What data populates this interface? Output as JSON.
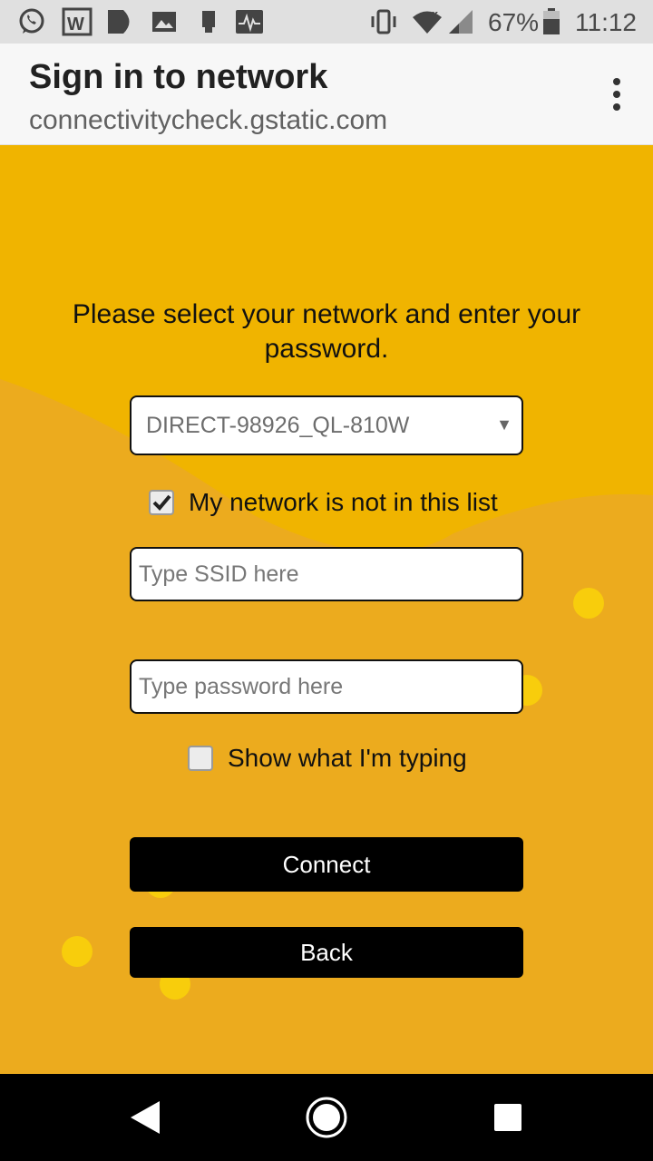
{
  "status_bar": {
    "battery_percent": "67%",
    "time": "11:12",
    "left_icons": [
      "whatsapp-icon",
      "word-icon",
      "play-icon",
      "gallery-icon",
      "sim-icon",
      "activity-icon"
    ],
    "right_icons": [
      "vibrate-icon",
      "wifi-icon",
      "signal-icon",
      "battery-icon"
    ]
  },
  "app_bar": {
    "title": "Sign in to network",
    "subtitle": "connectivitycheck.gstatic.com",
    "menu_icon": "more-vert-icon"
  },
  "form": {
    "prompt": "Please select your network and enter your password.",
    "network_select": {
      "selected_value": "DIRECT-98926_QL-810W"
    },
    "not_in_list": {
      "label": "My network is not in this list",
      "checked": true
    },
    "ssid_input": {
      "placeholder": "Type SSID here",
      "value": ""
    },
    "password_input": {
      "placeholder": "Type password here",
      "value": ""
    },
    "show_typing": {
      "label": "Show what I'm typing",
      "checked": false
    },
    "connect_label": "Connect",
    "back_label": "Back"
  },
  "colors": {
    "background": "#f0b400",
    "background_wave": "#ecab1e",
    "dot": "#f8cd0c",
    "button": "#000000"
  },
  "nav_bar": {
    "buttons": [
      "back-icon",
      "home-icon",
      "recents-icon"
    ]
  }
}
